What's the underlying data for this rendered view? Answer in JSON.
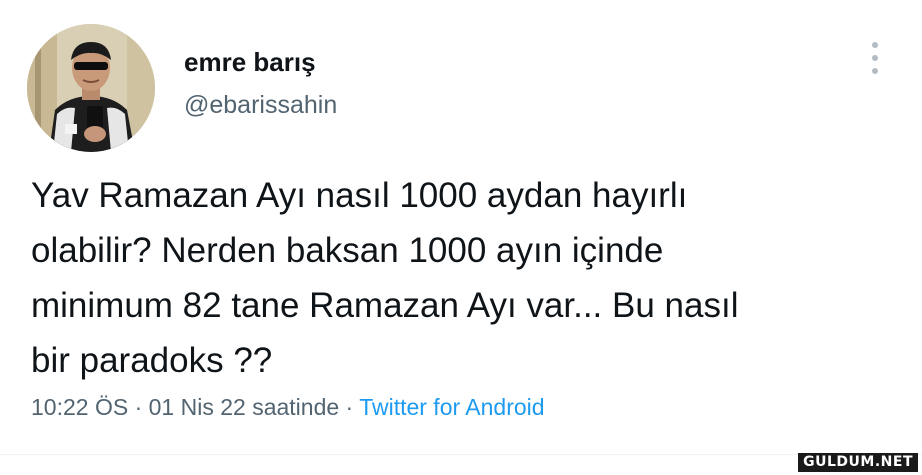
{
  "author": {
    "display_name": "emre barış",
    "handle": "@ebarissahin"
  },
  "tweet": {
    "text": "Yav Ramazan Ayı nasıl 1000 aydan hayırlı\nolabilir?  Nerden baksan 1000 ayın içinde\nminimum 82 tane Ramazan Ayı var... Bu nasıl\nbir paradoks ??",
    "time": "10:22 ÖS",
    "separator_1": " · ",
    "date": "01 Nis 22 saatinde",
    "separator_2": " · ",
    "source": "Twitter for Android"
  },
  "watermark": "GULDUM.NET",
  "icons": {
    "more": "more-vertical-icon"
  },
  "colors": {
    "text": "#0f1419",
    "secondary": "#536471",
    "link": "#1d9bf0"
  }
}
